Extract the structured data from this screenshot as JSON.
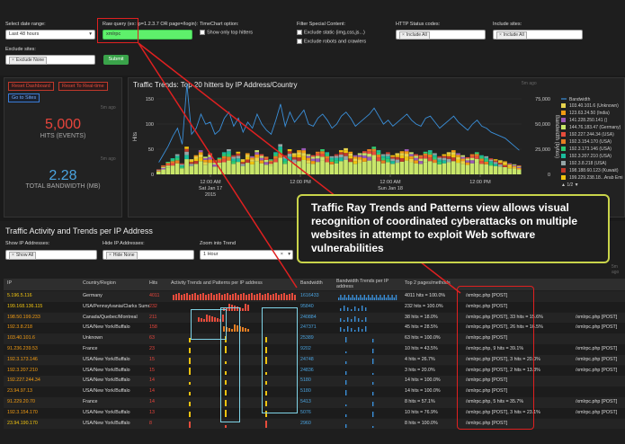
{
  "filters": {
    "date_range_label": "Select date range:",
    "date_range_value": "Last 48 hours",
    "raw_query_label": "Raw query (ex: ip=1.2.3.7 OR page=/login):",
    "raw_query_value": "xmlrpc",
    "timechart_label": "TimeChart option:",
    "timechart_option": "Show only top hitters",
    "special_label": "Filter Special Content:",
    "special_opt1": "Exclude static (img,css,js...)",
    "special_opt2": "Exclude robots and crawlers",
    "http_label": "HTTP Status codes:",
    "http_tag": "Include All",
    "include_label": "Include sites:",
    "include_tag": "Include All",
    "exclude_label": "Exclude sites:",
    "exclude_tag": "Exclude None",
    "submit": "Submit"
  },
  "side": {
    "reset_dashboard": "Reset Dashboard",
    "reset_realtime": "Reset To Real-time",
    "go_sites": "Go to Sites",
    "hits_value": "5,000",
    "hits_label": "HITS (EVENTS)",
    "bw_value": "2.28",
    "bw_label": "TOTAL BANDWIDTH (MB)",
    "ago1": "5m ago",
    "ago2": "5m ago"
  },
  "trend": {
    "title": "Traffic Trends: Top 20 hitters by IP Address/Country",
    "ago": "5m ago",
    "legend_title": "Bandwidth",
    "legend": [
      {
        "label": "103.40.101.6 (Unknown)",
        "color": "#e8d44d"
      },
      {
        "label": "123.63.24.50 (India)",
        "color": "#f39c12"
      },
      {
        "label": "141.228.250.141 ()",
        "color": "#9b59b6"
      },
      {
        "label": "144.76.183.47 (Germany)",
        "color": "#c8e66a"
      },
      {
        "label": "192.227.244.34 (USA)",
        "color": "#e74c3c"
      },
      {
        "label": "192.3.154.170 (USA)",
        "color": "#e67e22"
      },
      {
        "label": "192.3.173.146 (USA)",
        "color": "#2ecc71"
      },
      {
        "label": "192.3.207.210 (USA)",
        "color": "#1abc9c"
      },
      {
        "label": "192.3.8.218 (USA)",
        "color": "#95a5a6"
      },
      {
        "label": "198.188.60.123 (Kuwait)",
        "color": "#c0392b"
      },
      {
        "label": "199.229.238.18...Arab Emi",
        "color": "#f1c40f"
      }
    ],
    "legend_page": "1/2",
    "y_left_label": "Hits",
    "y_right_label": "Bandwidth (bytes)",
    "y_left_ticks": [
      "150",
      "100",
      "50",
      "0"
    ],
    "y_right_ticks": [
      "75,000",
      "50,000",
      "25,000",
      "0"
    ],
    "x_ticks": [
      {
        "l1": "12:00 AM",
        "l2": "Sat Jan 17",
        "l3": "2015"
      },
      {
        "l1": "12:00 PM",
        "l2": "",
        "l3": ""
      },
      {
        "l1": "12:00 AM",
        "l2": "Sun Jan 18",
        "l3": ""
      },
      {
        "l1": "12:00 PM",
        "l2": "",
        "l3": ""
      }
    ]
  },
  "chart_data": {
    "type": "bar",
    "title": "Traffic Trends: Top 20 hitters by IP Address/Country",
    "ylabel": "Hits",
    "ylabel_right": "Bandwidth (bytes)",
    "ylim": [
      0,
      150
    ],
    "ylim_right": [
      0,
      100000
    ],
    "x_ticks": [
      "12:00 AM Sat Jan 17 2015",
      "12:00 PM",
      "12:00 AM Sun Jan 18",
      "12:00 PM"
    ],
    "legend_placement": "right",
    "hits": [
      10,
      18,
      25,
      32,
      40,
      22,
      55,
      30,
      38,
      48,
      35,
      42,
      28,
      33,
      44,
      50,
      38,
      45,
      30,
      42,
      36,
      48,
      40,
      35,
      30,
      44,
      60,
      38,
      50,
      42,
      48,
      52,
      40,
      38,
      45,
      50,
      44,
      36,
      40,
      48,
      52,
      45,
      38,
      42,
      46,
      50,
      55,
      48,
      40,
      44,
      38,
      42,
      46,
      50,
      44,
      40,
      38,
      45,
      48,
      42,
      36,
      40,
      44,
      48,
      42,
      38,
      34,
      40,
      44,
      38,
      36,
      32,
      30,
      28,
      26,
      22,
      20,
      18
    ],
    "bandwidth": [
      12000,
      20000,
      28000,
      38000,
      46000,
      30000,
      90000,
      40000,
      46000,
      60000,
      50000,
      52000,
      40000,
      44000,
      56000,
      62000,
      48000,
      56000,
      42000,
      52000,
      46000,
      60000,
      50000,
      44000,
      40000,
      54000,
      70000,
      48000,
      62000,
      52000,
      58000,
      64000,
      50000,
      48000,
      56000,
      60000,
      54000,
      46000,
      50000,
      58000,
      62000,
      56000,
      48000,
      52000,
      56000,
      60000,
      66000,
      58000,
      50000,
      54000,
      48000,
      52000,
      56000,
      60000,
      54000,
      50000,
      48000,
      56000,
      58000,
      52000,
      46000,
      50000,
      54000,
      58000,
      52000,
      48000,
      44000,
      50000,
      54000,
      48000,
      46000,
      42000,
      40000,
      38000,
      36000,
      32000,
      28000,
      24000
    ]
  },
  "activity": {
    "title": "Traffic Activity and Trends per IP Address",
    "ago": "5m ago",
    "show_ip_label": "Show IP Addresses:",
    "show_ip_tag": "Show All",
    "hide_ip_label": "Hide IP Addresses:",
    "hide_ip_tag": "Hide None",
    "zoom_label": "Zoom into Trend",
    "zoom_value": "1 Hour",
    "columns": [
      "IP",
      "Country/Region",
      "Hits",
      "Activity Trends and Patterns per IP address",
      "Bandwidth",
      "Bandwidth Trends per IP address",
      "Top 2 pages/methods"
    ],
    "rows": [
      {
        "ip": "5.196.5.116",
        "country": "Germany",
        "hits": "4011",
        "bw": "1616433",
        "pages": "4011 hits = 100.0%",
        "p1": "/xmlrpc.php [POST]",
        "p2": "",
        "color": "#f1c40f",
        "act": "#e74c3c"
      },
      {
        "ip": "199.168.136.115",
        "country": "USA/Pennsylvania/Clarks Summit",
        "hits": "232",
        "bw": "95840",
        "pages": "232 hits = 100.0%",
        "p1": "/xmlrpc.php [POST]",
        "p2": "",
        "color": "#f1c40f",
        "act": "#e74c3c"
      },
      {
        "ip": "198.50.199.233",
        "country": "Canada/Quebec/Montreal",
        "hits": "211",
        "bw": "240884",
        "pages": "38 hits = 18.0%",
        "p1": "/xmlrpc.php [POST], 33 hits = 15.6%",
        "p2": "/xmlrpc.php [POST]",
        "color": "#f39c12",
        "act": "#e74c3c"
      },
      {
        "ip": "192.3.8.218",
        "country": "USA/New York/Buffalo",
        "hits": "158",
        "bw": "247371",
        "pages": "45 hits = 28.5%",
        "p1": "/xmlrpc.php [POST], 26 hits = 16.5%",
        "p2": "/xmlrpc.php [POST]",
        "color": "#f39c12",
        "act": "#e67e22"
      },
      {
        "ip": "103.40.101.6",
        "country": "Unknown",
        "hits": "63",
        "bw": "25389",
        "pages": "63 hits = 100.0%",
        "p1": "/xmlrpc.php [POST]",
        "p2": "",
        "color": "#f39c12",
        "act": "#f1c40f"
      },
      {
        "ip": "91.236.239.53",
        "country": "France",
        "hits": "23",
        "bw": "9202",
        "pages": "10 hits = 43.5%",
        "p1": "/xmlrpc.php, 9 hits = 39.1%",
        "p2": "/xmlrpc.php [POST]",
        "color": "#f39c12",
        "act": "#f1c40f"
      },
      {
        "ip": "192.3.173.146",
        "country": "USA/New York/Buffalo",
        "hits": "15",
        "bw": "24748",
        "pages": "4 hits = 26.7%",
        "p1": "/xmlrpc.php [POST], 3 hits = 20.0%",
        "p2": "/xmlrpc.php [POST]",
        "color": "#f39c12",
        "act": "#f1c40f"
      },
      {
        "ip": "192.3.207.210",
        "country": "USA/New York/Buffalo",
        "hits": "15",
        "bw": "24836",
        "pages": "3 hits = 20.0%",
        "p1": "/xmlrpc.php [POST], 2 hits = 13.3%",
        "p2": "/xmlrpc.php [POST]",
        "color": "#f39c12",
        "act": "#f1c40f"
      },
      {
        "ip": "192.227.244.34",
        "country": "USA/New York/Buffalo",
        "hits": "14",
        "bw": "5180",
        "pages": "14 hits = 100.0%",
        "p1": "/xmlrpc.php [POST]",
        "p2": "",
        "color": "#f39c12",
        "act": "#f1c40f"
      },
      {
        "ip": "23.94.97.13",
        "country": "USA/New York/Buffalo",
        "hits": "14",
        "bw": "5180",
        "pages": "14 hits = 100.0%",
        "p1": "/xmlrpc.php [POST]",
        "p2": "",
        "color": "#f39c12",
        "act": "#f1c40f"
      },
      {
        "ip": "91.229.20.70",
        "country": "France",
        "hits": "14",
        "bw": "5413",
        "pages": "8 hits = 57.1%",
        "p1": "/xmlrpc.php, 5 hits = 35.7%",
        "p2": "/xmlrpc.php [POST]",
        "color": "#f39c12",
        "act": "#f1c40f"
      },
      {
        "ip": "192.3.154.170",
        "country": "USA/New York/Buffalo",
        "hits": "13",
        "bw": "5076",
        "pages": "10 hits = 76.9%",
        "p1": "/xmlrpc.php [POST], 3 hits = 23.1%",
        "p2": "/xmlrpc.php [POST]",
        "color": "#f39c12",
        "act": "#f1c40f"
      },
      {
        "ip": "23.94.190.170",
        "country": "USA/New York/Buffalo",
        "hits": "8",
        "bw": "2960",
        "pages": "8 hits = 100.0%",
        "p1": "/xmlrpc.php [POST]",
        "p2": "",
        "color": "#f1c40f",
        "act": "#e74c3c"
      }
    ]
  },
  "callout": "Traffic Ray Trends and Patterns view allows visual recognition of coordinated cyberattacks on multiple websites in attempt to exploit Web software vulnerabilities",
  "colors": {
    "accent_red": "#e8453c",
    "accent_blue": "#4aa3df",
    "callout_border": "#c9d44a",
    "highlight_cyan": "#7fd3e6"
  }
}
